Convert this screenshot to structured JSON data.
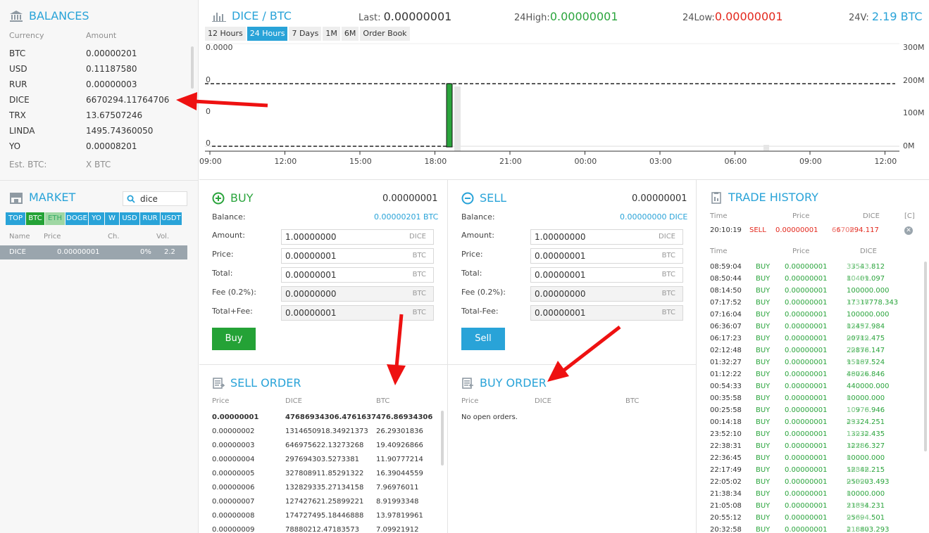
{
  "balances": {
    "title": "BALANCES",
    "col_currency": "Currency",
    "col_amount": "Amount",
    "rows": [
      {
        "currency": "BTC",
        "amount": "0.00000201"
      },
      {
        "currency": "USD",
        "amount": "0.11187580"
      },
      {
        "currency": "RUR",
        "amount": "0.00000003"
      },
      {
        "currency": "DICE",
        "amount": "6670294.11764706"
      },
      {
        "currency": "TRX",
        "amount": "13.67507246"
      },
      {
        "currency": "LINDA",
        "amount": "1495.74360050"
      },
      {
        "currency": "YO",
        "amount": "0.00008201"
      }
    ],
    "est_label": "Est. BTC:",
    "est_value": "X BTC"
  },
  "market": {
    "title": "MARKET",
    "search_value": "dice",
    "tabs": [
      "TOP",
      "BTC",
      "ETH",
      "DOGE",
      "YO",
      "W",
      "USD",
      "RUR",
      "USDT"
    ],
    "active_tab": "BTC",
    "col_name": "Name",
    "col_price": "Price",
    "col_ch": "Ch.",
    "col_vol": "Vol.",
    "rows": [
      {
        "name": "DICE",
        "price": "0.00000001",
        "ch": "0%",
        "vol": "2.2"
      }
    ]
  },
  "chart": {
    "pair_base": "DICE",
    "pair_sep": " / ",
    "pair_quote": "BTC",
    "last_label": "Last:",
    "last_value": "0.00000001",
    "high_label": "24High:",
    "high_value": "0.00000001",
    "low_label": "24Low:",
    "low_value": "0.00000001",
    "vol_label": "24V:",
    "vol_value": "2.19 BTC",
    "ranges": [
      "12 Hours",
      "24 Hours",
      "7 Days",
      "1M",
      "6M",
      "Order Book"
    ],
    "active_range": "24 Hours",
    "price_top_label": "0.0000",
    "left_ticks": [
      "0",
      "0",
      "0"
    ],
    "right_ticks": [
      "300M",
      "200M",
      "100M",
      "0M"
    ],
    "x_ticks": [
      "09:00",
      "12:00",
      "15:00",
      "18:00",
      "21:00",
      "00:00",
      "03:00",
      "06:00",
      "09:00",
      "12:00"
    ],
    "colors": {
      "candle": "#2aa43c",
      "volume_bar": "#e6e6e6"
    }
  },
  "buy": {
    "title": "BUY",
    "price_display": "0.00000001",
    "balance_label": "Balance:",
    "balance_value": "0.00000201 BTC",
    "amount_label": "Amount:",
    "amount_value": "1.00000000",
    "amount_unit": "DICE",
    "price_label": "Price:",
    "price_value": "0.00000001",
    "price_unit": "BTC",
    "total_label": "Total:",
    "total_value": "0.00000001",
    "total_unit": "BTC",
    "fee_label": "Fee (0.2%):",
    "fee_value": "0.00000000",
    "fee_unit": "BTC",
    "totalfee_label": "Total+Fee:",
    "totalfee_value": "0.00000001",
    "totalfee_unit": "BTC",
    "button": "Buy"
  },
  "sell": {
    "title": "SELL",
    "price_display": "0.00000001",
    "balance_label": "Balance:",
    "balance_value": "0.00000000 DICE",
    "amount_label": "Amount:",
    "amount_value": "1.00000000",
    "amount_unit": "DICE",
    "price_label": "Price:",
    "price_value": "0.00000001",
    "price_unit": "BTC",
    "total_label": "Total:",
    "total_value": "0.00000001",
    "total_unit": "BTC",
    "fee_label": "Fee (0.2%):",
    "fee_value": "0.00000000",
    "fee_unit": "BTC",
    "totalfee_label": "Total-Fee:",
    "totalfee_value": "0.00000001",
    "totalfee_unit": "BTC",
    "button": "Sell"
  },
  "sell_order": {
    "title": "SELL ORDER",
    "col_price": "Price",
    "col_dice": "DICE",
    "col_btc": "BTC",
    "rows": [
      {
        "price": "0.00000001",
        "dice": "47686934306.4761637",
        "btc": "476.86934306"
      },
      {
        "price": "0.00000002",
        "dice": "1314650918.34921373",
        "btc": "26.29301836"
      },
      {
        "price": "0.00000003",
        "dice": "646975622.13273268",
        "btc": "19.40926866"
      },
      {
        "price": "0.00000004",
        "dice": "297694303.5273381",
        "btc": "11.90777214"
      },
      {
        "price": "0.00000005",
        "dice": "327808911.85291322",
        "btc": "16.39044559"
      },
      {
        "price": "0.00000006",
        "dice": "132829335.27134158",
        "btc": "7.96976011"
      },
      {
        "price": "0.00000007",
        "dice": "127427621.25899221",
        "btc": "8.91993348"
      },
      {
        "price": "0.00000008",
        "dice": "174727495.18446888",
        "btc": "13.97819961"
      },
      {
        "price": "0.00000009",
        "dice": "78880212.47183573",
        "btc": "7.09921912"
      }
    ]
  },
  "buy_order": {
    "title": "BUY ORDER",
    "col_price": "Price",
    "col_dice": "DICE",
    "col_btc": "BTC",
    "empty": "No open orders."
  },
  "trade_history": {
    "title": "TRADE HISTORY",
    "col_time": "Time",
    "col_price": "Price",
    "col_dice": "DICE",
    "col_c": "[C]",
    "mine": {
      "time": "20:10:19",
      "side": "SELL",
      "price": "0.00000001",
      "amount_main": "6670294.117",
      "amount_tail": "64706"
    },
    "col_time2": "Time",
    "col_price2": "Price",
    "col_dice2": "DICE",
    "rows": [
      {
        "time": "08:59:04",
        "side": "BUY",
        "price": "0.00000001",
        "main": "33543.812",
        "tail": "37523"
      },
      {
        "time": "08:50:44",
        "side": "BUY",
        "price": "0.00000001",
        "main": "10401.097",
        "tail": "80439"
      },
      {
        "time": "08:14:50",
        "side": "BUY",
        "price": "0.00000001",
        "main": "100000.000",
        "tail": ""
      },
      {
        "time": "07:17:52",
        "side": "BUY",
        "price": "0.00000001",
        "main": "17317778.343",
        "tail": "31336"
      },
      {
        "time": "07:16:04",
        "side": "BUY",
        "price": "0.00000001",
        "main": "100000.000",
        "tail": ""
      },
      {
        "time": "06:36:07",
        "side": "BUY",
        "price": "0.00000001",
        "main": "12457.984",
        "tail": "03193"
      },
      {
        "time": "06:17:23",
        "side": "BUY",
        "price": "0.00000001",
        "main": "20712.475",
        "tail": "04989"
      },
      {
        "time": "02:12:48",
        "side": "BUY",
        "price": "0.00000001",
        "main": "22876.147",
        "tail": "70459"
      },
      {
        "time": "01:32:27",
        "side": "BUY",
        "price": "0.00000001",
        "main": "15187.524",
        "tail": "95009"
      },
      {
        "time": "01:12:22",
        "side": "BUY",
        "price": "0.00000001",
        "main": "48026.846",
        "tail": "30737"
      },
      {
        "time": "00:54:33",
        "side": "BUY",
        "price": "0.00000001",
        "main": "440000.000",
        "tail": ""
      },
      {
        "time": "00:35:58",
        "side": "BUY",
        "price": "0.00000001",
        "main": "10000.000",
        "tail": "0"
      },
      {
        "time": "00:25:58",
        "side": "BUY",
        "price": "0.00000001",
        "main": "10976.946",
        "tail": "10778"
      },
      {
        "time": "00:14:18",
        "side": "BUY",
        "price": "0.00000001",
        "main": "23324.251",
        "tail": "497"
      },
      {
        "time": "23:52:10",
        "side": "BUY",
        "price": "0.00000001",
        "main": "13232.435",
        "tail": "12974"
      },
      {
        "time": "22:38:31",
        "side": "BUY",
        "price": "0.00000001",
        "main": "12286.327",
        "tail": "3453"
      },
      {
        "time": "22:36:45",
        "side": "BUY",
        "price": "0.00000001",
        "main": "10000.000",
        "tail": "0"
      },
      {
        "time": "22:17:49",
        "side": "BUY",
        "price": "0.00000001",
        "main": "12342.215",
        "tail": "56886"
      },
      {
        "time": "22:05:02",
        "side": "BUY",
        "price": "0.00000001",
        "main": "250203.493",
        "tail": "01397"
      },
      {
        "time": "21:38:34",
        "side": "BUY",
        "price": "0.00000001",
        "main": "10000.000",
        "tail": "0"
      },
      {
        "time": "21:05:08",
        "side": "BUY",
        "price": "0.00000001",
        "main": "21834.231",
        "tail": "53691"
      },
      {
        "time": "20:55:12",
        "side": "BUY",
        "price": "0.00000001",
        "main": "25694.501",
        "tail": "97804"
      },
      {
        "time": "20:32:58",
        "side": "BUY",
        "price": "0.00000001",
        "main": "218803.293",
        "tail": "41317"
      }
    ]
  }
}
